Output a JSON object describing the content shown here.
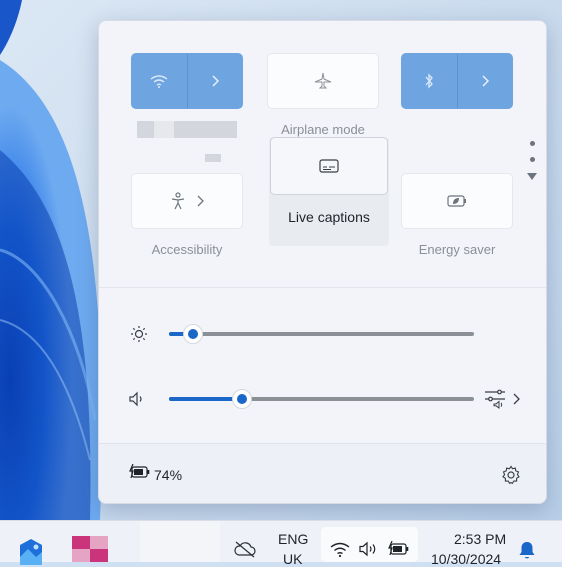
{
  "quick_settings": {
    "tiles": [
      {
        "name": "Wi-Fi",
        "label": "",
        "state": "on",
        "icon": "wifi-icon"
      },
      {
        "name": "Airplane mode",
        "label": "Airplane mode",
        "state": "off",
        "icon": "airplane-icon"
      },
      {
        "name": "Bluetooth",
        "label": "",
        "state": "on",
        "icon": "bluetooth-icon"
      },
      {
        "name": "Accessibility",
        "label": "Accessibility",
        "state": "off",
        "icon": "accessibility-icon"
      },
      {
        "name": "Live captions",
        "label": "Live captions",
        "state": "off",
        "icon": "captions-icon"
      },
      {
        "name": "Energy saver",
        "label": "Energy saver",
        "state": "off",
        "icon": "energy-saver-icon"
      }
    ],
    "brightness": {
      "value": 0.08,
      "icon": "brightness-icon"
    },
    "volume": {
      "value": 0.24,
      "icon": "speaker-icon"
    },
    "battery_percent": "74%",
    "accent_color": "#1b66c9",
    "tile_on_color": "#6ea5e0"
  },
  "taskbar": {
    "language_top": "ENG",
    "language_bottom": "UK",
    "time": "2:53 PM",
    "date": "10/30/2024"
  }
}
